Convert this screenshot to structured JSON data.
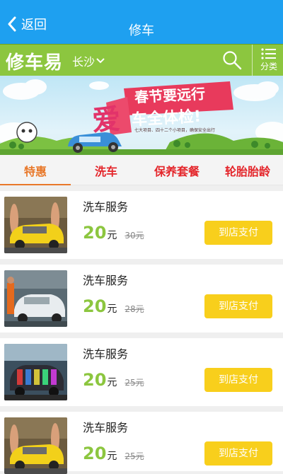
{
  "header": {
    "back_label": "返回",
    "title": "修车"
  },
  "subbar": {
    "logo": "修车易",
    "city": "长沙",
    "category_label": "分类"
  },
  "banner": {
    "headline_1": "春节要远行",
    "big_char": "爱",
    "headline_2": "车全体检!",
    "caption": "七大项目、四十二个小项目，确保安全出行"
  },
  "tabs": [
    {
      "label": "特惠"
    },
    {
      "label": "洗车"
    },
    {
      "label": "保养套餐"
    },
    {
      "label": "轮胎胎龄"
    }
  ],
  "items": [
    {
      "name": "洗车服务",
      "price": "20",
      "unit": "元",
      "original": "30元",
      "button": "到店支付"
    },
    {
      "name": "洗车服务",
      "price": "20",
      "unit": "元",
      "original": "28元",
      "button": "到店支付"
    },
    {
      "name": "洗车服务",
      "price": "20",
      "unit": "元",
      "original": "25元",
      "button": "到店支付"
    },
    {
      "name": "洗车服务",
      "price": "20",
      "unit": "元",
      "original": "25元",
      "button": "到店支付"
    }
  ],
  "colors": {
    "header_blue": "#1ea0f0",
    "brand_green": "#8cc63f",
    "tab_red": "#e4262b",
    "tab_active": "#e8782a",
    "button_yellow": "#f8cf1c"
  }
}
